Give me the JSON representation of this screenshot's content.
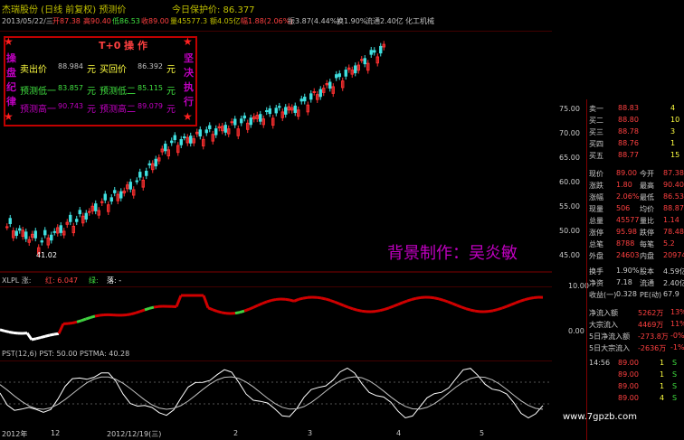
{
  "window": {
    "title": "杰瑞股份 (日线 前复权) 预测价",
    "protect_price": "今日保护价: 86.377"
  },
  "info_bar": {
    "date": "2013/05/22/三",
    "open": "开87.38",
    "high": "高90.40",
    "low": "低86.53",
    "close": "收89.00",
    "volume": "量45577.3",
    "change": "额4.05亿",
    "ratio": "幅1.88(2.06%)",
    "amp": "振3.87(4.44%)",
    "turnover": "换1.90%",
    "float": "流通2.40亿",
    "sector": "化工机械"
  },
  "t0_box": {
    "title": "T+0 操 作",
    "left_chars": [
      "操",
      "盘",
      "纪",
      "律"
    ],
    "right_chars": [
      "坚",
      "决",
      "执",
      "行"
    ],
    "rows": [
      {
        "label": "卖出价",
        "value": "88.984",
        "unit": "元",
        "label2": "买回价",
        "value2": "86.392",
        "unit2": "元"
      },
      {
        "label": "预测低一",
        "value": "83.857",
        "unit": "元",
        "label2": "预测低二",
        "value2": "85.115",
        "unit2": "元"
      },
      {
        "label": "预测高一",
        "value": "90.743",
        "unit": "元",
        "label2": "预测高二",
        "value2": "89.079",
        "unit2": "元"
      }
    ]
  },
  "main_chart": {
    "price_labels": [
      "75.00",
      "70.00",
      "65.00",
      "60.00",
      "55.00",
      "50.00",
      "45.00"
    ],
    "low_marker": "41.02",
    "watermark": "背景制作：吴炎敏",
    "colors": {
      "up": "#ff3030",
      "down": "#40e0e0",
      "ma": "#ffffff"
    }
  },
  "xlpl": {
    "label": "XLPL 涨:",
    "v1": "红: 6.047",
    "v2": "绿:",
    "v3": "落: -",
    "axis": [
      "10.00",
      "0.00"
    ]
  },
  "pst": {
    "label": "PST(12,6) PST: 50.00",
    "pstma": "PSTMA: 40.28",
    "axis": [
      "60.00",
      "40.00"
    ]
  },
  "xaxis": {
    "labels": [
      "2012年",
      "12",
      "2012/12/19(三)",
      "2",
      "3",
      "4",
      "5"
    ]
  },
  "order_book": [
    {
      "label": "卖一",
      "price": "88.83",
      "vol": "4"
    },
    {
      "label": "买二",
      "price": "88.80",
      "vol": "10"
    },
    {
      "label": "买三",
      "price": "88.78",
      "vol": "3"
    },
    {
      "label": "买四",
      "price": "88.76",
      "vol": "1"
    },
    {
      "label": "买五",
      "price": "88.77",
      "vol": "15"
    }
  ],
  "quote": [
    {
      "l1": "现价",
      "v1": "89.00",
      "l2": "今开",
      "v2": "87.38"
    },
    {
      "l1": "涨跌",
      "v1": "1.80",
      "l2": "最高",
      "v2": "90.40"
    },
    {
      "l1": "涨幅",
      "v1": "2.06%",
      "l2": "最低",
      "v2": "86.53"
    },
    {
      "l1": "现量",
      "v1": "506",
      "l2": "均价",
      "v2": "88.87"
    },
    {
      "l1": "总量",
      "v1": "45577",
      "l2": "量比",
      "v2": "1.14"
    },
    {
      "l1": "涨停",
      "v1": "95.98",
      "l2": "跌停",
      "v2": "78.48"
    },
    {
      "l1": "总笔",
      "v1": "8788",
      "l2": "每笔",
      "v2": "5.2"
    },
    {
      "l1": "外盘",
      "v1": "24603",
      "l2": "内盘",
      "v2": "20974"
    }
  ],
  "stats": [
    {
      "l1": "换手",
      "v1": "1.90%",
      "l2": "股本",
      "v2": "4.59亿"
    },
    {
      "l1": "净资",
      "v1": "7.18",
      "l2": "流通",
      "v2": "2.40亿"
    },
    {
      "l1": "收益(一)",
      "v1": "0.328",
      "l2": "PE(动)",
      "v2": "67.9"
    }
  ],
  "flows": [
    {
      "label": "净流入额",
      "v1": "5262万",
      "v2": "13%"
    },
    {
      "label": "大宗流入",
      "v1": "4469万",
      "v2": "11%"
    },
    {
      "label": "5日净流入额",
      "v1": "-273.8万",
      "v2": "-0%"
    },
    {
      "label": "5日大宗流入",
      "v1": "-2636万",
      "v2": "-1%"
    }
  ],
  "ticks": [
    {
      "time": "14:56",
      "price": "89.00",
      "vol": "1",
      "s": "S"
    },
    {
      "time": "",
      "price": "89.00",
      "vol": "1",
      "s": "S"
    },
    {
      "time": "",
      "price": "89.00",
      "vol": "1",
      "s": "S"
    },
    {
      "time": "",
      "price": "89.00",
      "vol": "4",
      "s": "S"
    }
  ],
  "website": "www.7gpzb.com"
}
